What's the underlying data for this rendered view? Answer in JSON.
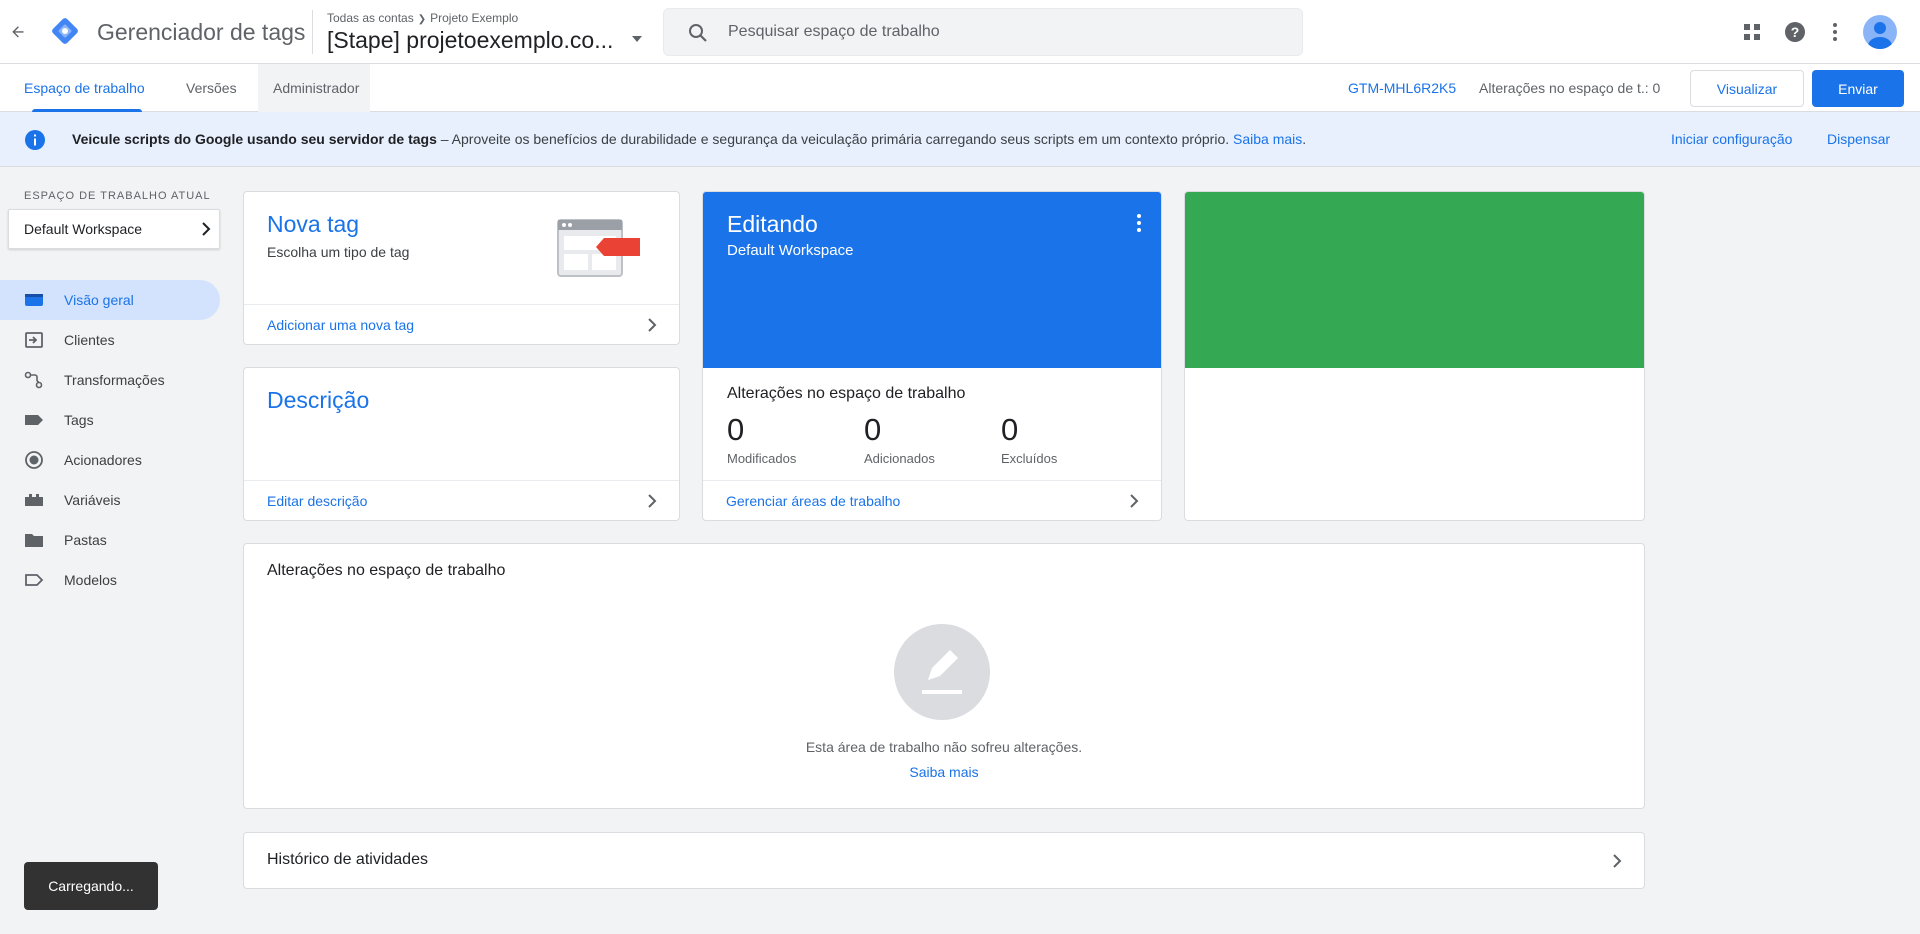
{
  "header": {
    "product_name": "Gerenciador de tags",
    "breadcrumb": {
      "accounts": "Todas as contas",
      "account": "Projeto Exemplo"
    },
    "container_name": "[Stape] projetoexemplo.co...",
    "search_placeholder": "Pesquisar espaço de trabalho"
  },
  "tabs": {
    "workspace": "Espaço de trabalho",
    "versions": "Versões",
    "admin": "Administrador",
    "container_id": "GTM-MHL6R2K5",
    "changes_count": "Alterações no espaço de t.: 0",
    "preview_label": "Visualizar",
    "submit_label": "Enviar"
  },
  "banner": {
    "bold_text": "Veicule scripts do Google usando seu servidor de tags",
    "text": " – Aproveite os benefícios de durabilidade e segurança da veiculação primária carregando seus scripts em um contexto próprio. ",
    "learn_more": "Saiba mais",
    "period": ".",
    "setup_label": "Iniciar configuração",
    "dismiss_label": "Dispensar"
  },
  "sidebar": {
    "section_label": "ESPAÇO DE TRABALHO ATUAL",
    "workspace_name": "Default Workspace",
    "items": [
      {
        "label": "Visão geral",
        "icon": "overview-icon",
        "active": true
      },
      {
        "label": "Clientes",
        "icon": "clients-icon"
      },
      {
        "label": "Transformações",
        "icon": "transformations-icon"
      },
      {
        "label": "Tags",
        "icon": "tag-icon"
      },
      {
        "label": "Acionadores",
        "icon": "trigger-icon"
      },
      {
        "label": "Variáveis",
        "icon": "variables-icon"
      },
      {
        "label": "Pastas",
        "icon": "folder-icon"
      },
      {
        "label": "Modelos",
        "icon": "templates-icon"
      }
    ]
  },
  "new_tag_card": {
    "title": "Nova tag",
    "subtitle": "Escolha um tipo de tag",
    "footer_link": "Adicionar uma nova tag"
  },
  "description_card": {
    "title": "Descrição",
    "footer_link": "Editar descrição"
  },
  "editing_card": {
    "title": "Editando",
    "workspace": "Default Workspace",
    "changes_heading": "Alterações no espaço de trabalho",
    "stats": [
      {
        "value": "0",
        "label": "Modificados"
      },
      {
        "value": "0",
        "label": "Adicionados"
      },
      {
        "value": "0",
        "label": "Excluídos"
      }
    ],
    "footer_link": "Gerenciar áreas de trabalho"
  },
  "workspace_changes": {
    "title": "Alterações no espaço de trabalho",
    "empty_text": "Esta área de trabalho não sofreu alterações.",
    "learn_more": "Saiba mais"
  },
  "activity_history": {
    "title": "Histórico de atividades"
  },
  "toast": {
    "text": "Carregando..."
  },
  "colors": {
    "primary": "#1a73e8",
    "green_card": "#34a853",
    "banner_bg": "#e8f0fe",
    "tag_red": "#ea4335"
  }
}
